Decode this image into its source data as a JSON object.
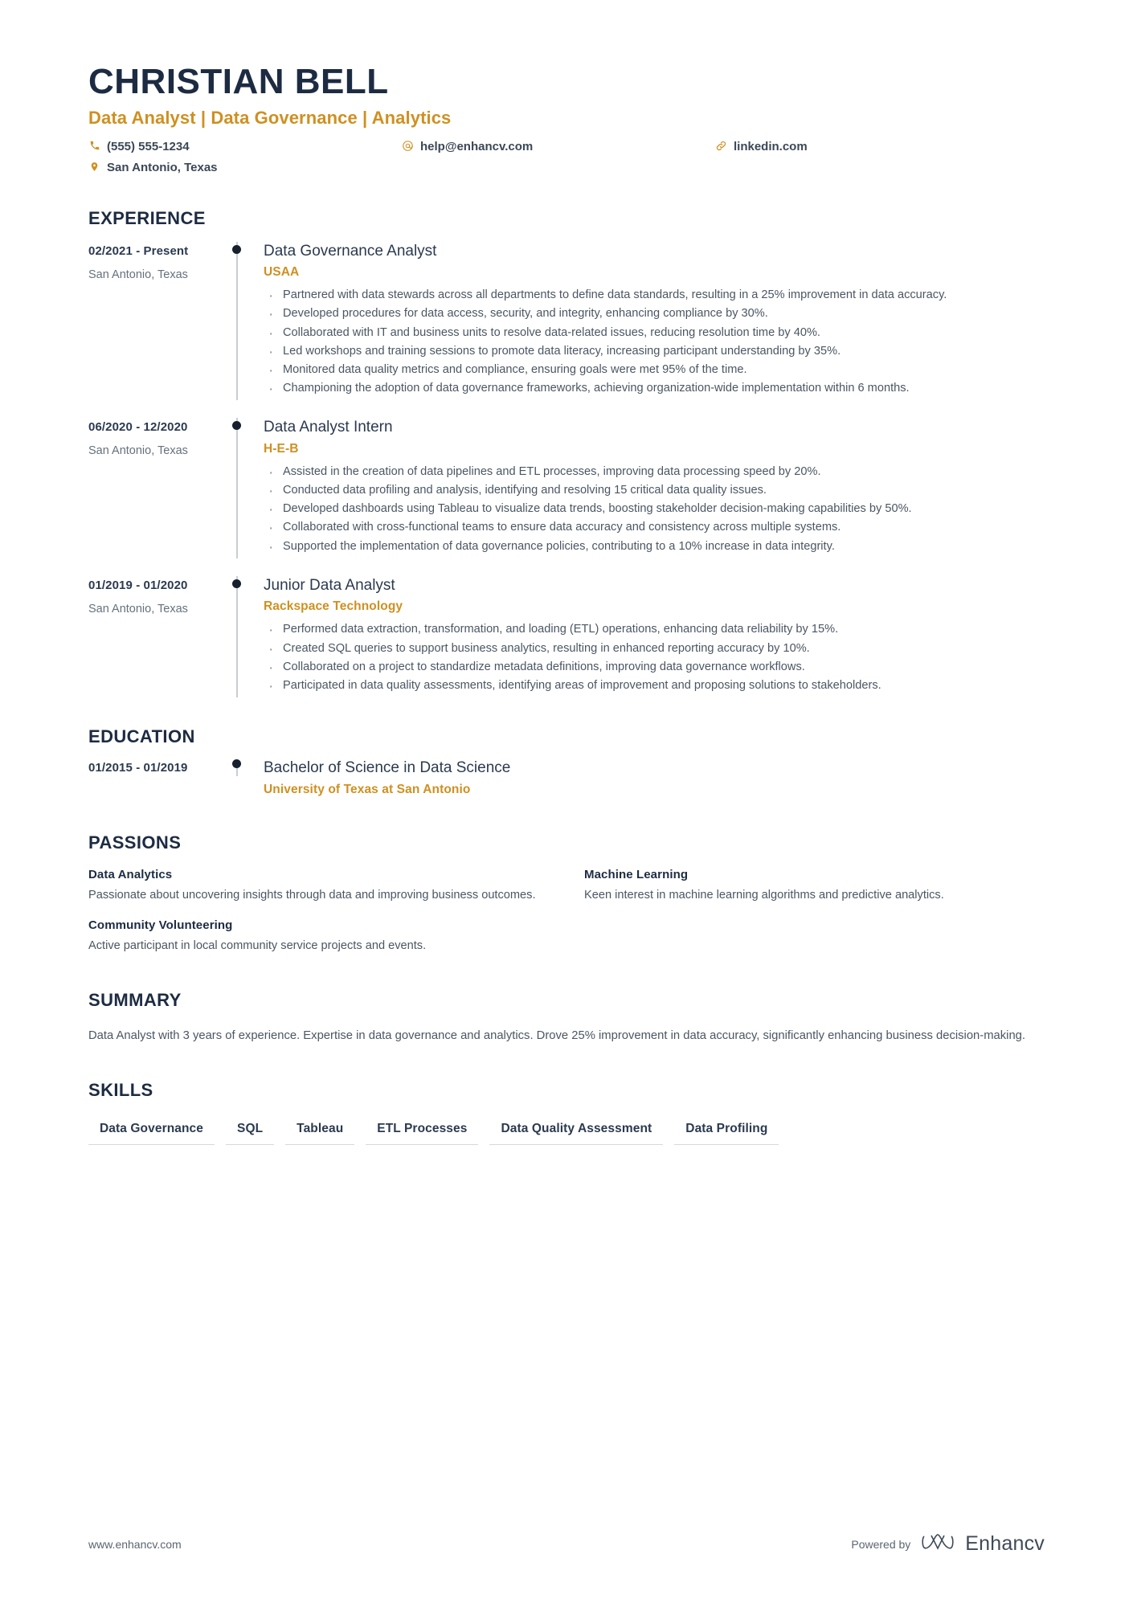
{
  "header": {
    "name": "CHRISTIAN BELL",
    "headline": "Data Analyst | Data Governance | Analytics",
    "contacts": [
      {
        "icon": "phone-icon",
        "value": "(555) 555-1234"
      },
      {
        "icon": "email-icon",
        "value": "help@enhancv.com"
      },
      {
        "icon": "link-icon",
        "value": "linkedin.com"
      },
      {
        "icon": "location-icon",
        "value": "San Antonio, Texas"
      }
    ]
  },
  "sections": {
    "experience_title": "EXPERIENCE",
    "education_title": "EDUCATION",
    "passions_title": "PASSIONS",
    "summary_title": "SUMMARY",
    "skills_title": "SKILLS"
  },
  "experience": [
    {
      "date": "02/2021 - Present",
      "location": "San Antonio, Texas",
      "role": "Data Governance Analyst",
      "company": "USAA",
      "bullets": [
        "Partnered with data stewards across all departments to define data standards, resulting in a 25% improvement in data accuracy.",
        "Developed procedures for data access, security, and integrity, enhancing compliance by 30%.",
        "Collaborated with IT and business units to resolve data-related issues, reducing resolution time by 40%.",
        "Led workshops and training sessions to promote data literacy, increasing participant understanding by 35%.",
        "Monitored data quality metrics and compliance, ensuring goals were met 95% of the time.",
        "Championing the adoption of data governance frameworks, achieving organization-wide implementation within 6 months."
      ]
    },
    {
      "date": "06/2020 - 12/2020",
      "location": "San Antonio, Texas",
      "role": "Data Analyst Intern",
      "company": "H-E-B",
      "bullets": [
        "Assisted in the creation of data pipelines and ETL processes, improving data processing speed by 20%.",
        "Conducted data profiling and analysis, identifying and resolving 15 critical data quality issues.",
        "Developed dashboards using Tableau to visualize data trends, boosting stakeholder decision-making capabilities by 50%.",
        "Collaborated with cross-functional teams to ensure data accuracy and consistency across multiple systems.",
        "Supported the implementation of data governance policies, contributing to a 10% increase in data integrity."
      ]
    },
    {
      "date": "01/2019 - 01/2020",
      "location": "San Antonio, Texas",
      "role": "Junior Data Analyst",
      "company": "Rackspace Technology",
      "bullets": [
        "Performed data extraction, transformation, and loading (ETL) operations, enhancing data reliability by 15%.",
        "Created SQL queries to support business analytics, resulting in enhanced reporting accuracy by 10%.",
        "Collaborated on a project to standardize metadata definitions, improving data governance workflows.",
        "Participated in data quality assessments, identifying areas of improvement and proposing solutions to stakeholders."
      ]
    }
  ],
  "education": [
    {
      "date": "01/2015 - 01/2019",
      "degree": "Bachelor of Science in Data Science",
      "school": "University of Texas at San Antonio"
    }
  ],
  "passions": [
    {
      "name": "Data Analytics",
      "description": "Passionate about uncovering insights through data and improving business outcomes."
    },
    {
      "name": "Machine Learning",
      "description": "Keen interest in machine learning algorithms and predictive analytics."
    },
    {
      "name": "Community Volunteering",
      "description": "Active participant in local community service projects and events."
    }
  ],
  "summary": {
    "text": "Data Analyst with 3 years of experience. Expertise in data governance and analytics. Drove 25% improvement in data accuracy, significantly enhancing business decision-making."
  },
  "skills": [
    "Data Governance",
    "SQL",
    "Tableau",
    "ETL Processes",
    "Data Quality Assessment",
    "Data Profiling"
  ],
  "footer": {
    "url": "www.enhancv.com",
    "powered_by": "Powered by",
    "brand": "Enhancv"
  },
  "colors": {
    "accent": "#cf9021",
    "heading": "#1d2b42",
    "body": "#4b5663"
  }
}
